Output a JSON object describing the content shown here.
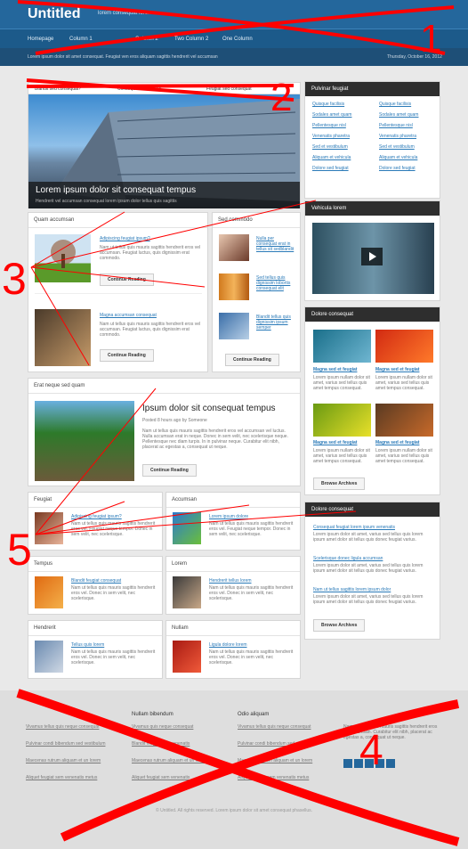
{
  "header": {
    "logo": "Untitled",
    "tagline": "lorem consequat lorem",
    "nav": [
      "Homepage",
      "Column 1",
      "Column 2",
      "Two Column 2",
      "One Column"
    ]
  },
  "crumb": {
    "path": "Lorem ipsum dolor sit amet consequat. Feugiat ven eros aliquam sagittis hendrerit vel accumsan",
    "date": "Thursday, October 16, 2012"
  },
  "feature": {
    "tabs": [
      "Blandit sed consequat?",
      "Consequat vestibulum",
      "Feugiat sed consequat"
    ],
    "title": "Lorem ipsum dolor sit consequat tempus",
    "sub": "Hendrerit vel accumsan consequat lorem ipsum dolor tellus quis sagittis"
  },
  "quam": {
    "title": "Quam accumsan",
    "items": [
      {
        "link": "Adipiscing feugiat ipsum?",
        "text": "Nam ut tellus quis mauris sagittis hendrerit eros vel accumsan. Feugiat luctus, quis dignissim erat commodo.",
        "btn": "Continue Reading"
      },
      {
        "link": "Magna accumsan consequat",
        "text": "Nam ut tellus quis mauris sagittis hendrerit eros vel accumsan. Feugiat luctus, quis dignissim erat commodo.",
        "btn": "Continue Reading"
      }
    ]
  },
  "commodo": {
    "title": "Sed commodo",
    "items": [
      {
        "link": "Nulla per consequat erat in tellus sit sedblandit"
      },
      {
        "link": "Sed tellus quis dignissim lobortis consequat elit"
      },
      {
        "link": "Blandit tellus quis dignissim ipsum semper"
      }
    ],
    "btn": "Continue Reading"
  },
  "erat": {
    "title": "Erat neque sed quam",
    "headline": "Ipsum dolor sit consequat tempus",
    "meta": "Posted 8 hours ago by Someone",
    "text": "Nam ut tellus quis mauris sagittis hendrerit eros vel accumsan vel luctus. Nulla accumsan erat in neque. Donec in sem velit, nec scelerisque neque. Pellentesque nec diam turpis. In in pulvinar neque. Curabitur elit nibh, placerat ac egestas a, consequat ut neque.",
    "btn": "Continue Reading"
  },
  "small": [
    {
      "title": "Feugiat",
      "link": "Adipiscing feugiat ipsum?",
      "text": "Nam ut tellus quis mauris sagittis hendrerit eros vel. Feugiat neque tempor. Donec in sem velit, nec scelerisque."
    },
    {
      "title": "Accumsan",
      "link": "Lorem ipsum dolore",
      "text": "Nam ut tellus quis mauris sagittis hendrerit eros vel. Feugiat neque tempor. Donec in sem velit, nec scelerisque."
    },
    {
      "title": "Tempus",
      "link": "Blandit feugiat consequat",
      "text": "Nam ut tellus quis mauris sagittis hendrerit eros vel. Donec in sem velit, nec scelerisque."
    },
    {
      "title": "Lorem",
      "link": "Hendrerit tellus lorem",
      "text": "Nam ut tellus quis mauris sagittis hendrerit eros vel. Donec in sem velit, nec scelerisque."
    },
    {
      "title": "Hendrerit",
      "link": "Tellus quis lorem",
      "text": "Nam ut tellus quis mauris sagittis hendrerit eros vel. Donec in sem velit, nec scelerisque."
    },
    {
      "title": "Nullam",
      "link": "Ligula dolore lorem",
      "text": "Nam ut tellus quis mauris sagittis hendrerit eros vel. Donec in sem velit, nec scelerisque."
    }
  ],
  "sidebar": {
    "pulvinar": {
      "title": "Pulvinar feugiat",
      "links": [
        [
          "Quisque facilisis",
          "Quisque facilisis"
        ],
        [
          "Sodales amet quam",
          "Sodales amet quam"
        ],
        [
          "Pellentesque nisl",
          "Pellentesque nisl"
        ],
        [
          "Venenatis pharetra",
          "Venenatis pharetra"
        ],
        [
          "Sed et vestibulum",
          "Sed et vestibulum"
        ],
        [
          "Aliquam et vehicula",
          "Aliquam et vehicula"
        ],
        [
          "Dolore sed feugiat",
          "Dolore sed feugiat"
        ]
      ]
    },
    "vehicula": {
      "title": "Vehicula lorem"
    },
    "dolore": {
      "title": "Dolore consequat",
      "items": [
        "Magna sed et feugiat",
        "Magna sed et feugiat",
        "Magna sed et feugiat",
        "Magna sed et feugiat"
      ],
      "text": "Lorem ipsum nullam dolor sit amet, varius sed tellus quis amet tempus consequat.",
      "btn": "Browse Archives"
    },
    "dolore2": {
      "title": "Dolore consequat",
      "items": [
        "Consequat feugiat lorem ipsum venenatis",
        "Scelerisque donec ligula accumsan",
        "Nam ut tellus sagittis lorem ipsum dolor"
      ],
      "text": "Lorem ipsum dolor sit amet, varius sed tellus quis lorem ipsum amet dolor sit tellus quis donec feugiat varius.",
      "btn": "Browse Archives"
    }
  },
  "footer": {
    "cols": [
      "",
      "Nullam bibendum",
      "Odio aliquam",
      ""
    ],
    "links1": [
      "Vivamus tellus quis neque consequat",
      "Pulvinar condi bibendum sed vestibulum",
      "Maecenas rutrum aliquam et un lorem",
      "Aliquet feugiat sem venenatis metus"
    ],
    "links2": [
      "Vivamus quis neque consequat",
      "Blandit feugiat sem venenatis",
      "Maecenas rutrum aliquam et un lorem",
      "Aliquet feugiat sem venenatis"
    ],
    "links3": [
      "Vivamus tellus quis neque consequat",
      "Pulvinar condi bibendum sed",
      "Maecenas rutrum aliquam et un lorem",
      "Aliquet feugiat sem venenatis metus"
    ],
    "text": "Nam ut tellus quis mauris sagittis hendrerit eros vel accumsan. Curabitur elit nibh, placerat ac egestas a, consequat ut neque.",
    "copyright": "© Untitled. All rights reserved. Lorem ipsum dolor sit amet consequat phasellus."
  },
  "annotations": [
    "1",
    "2",
    "3",
    "5",
    "4"
  ],
  "colors": {
    "accent": "#24679c",
    "annotation": "#ff0000"
  }
}
